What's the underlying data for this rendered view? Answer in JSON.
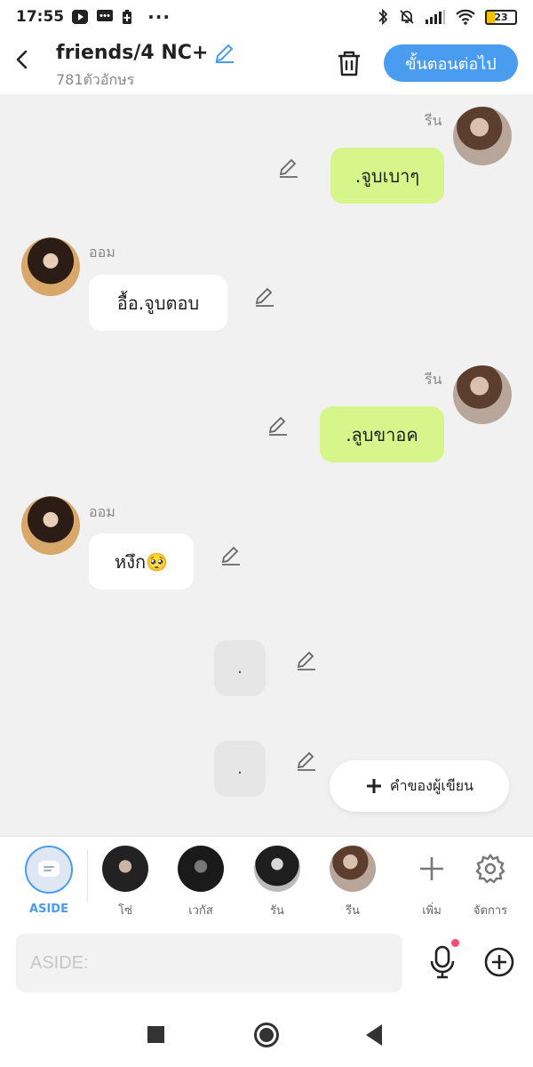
{
  "status_bar": {
    "time": "17:55",
    "battery": "23"
  },
  "header": {
    "title": "friends/4 NC+",
    "subtitle": "781ตัวอักษร",
    "next_label": "ขั้นตอนต่อไป"
  },
  "messages": [
    {
      "sender": "รีน",
      "text": ".จูบเบาๆ"
    },
    {
      "sender": "ออม",
      "text": "อื้อ.จูบตอบ"
    },
    {
      "sender": "รีน",
      "text": ".ลูบขาอค"
    },
    {
      "sender": "ออม",
      "text": "หงึก🥺"
    },
    {
      "text": "."
    },
    {
      "text": "."
    }
  ],
  "author_button": "คำของผู้เขียน",
  "characters": {
    "aside": "ASIDE",
    "items": [
      {
        "name": "โซ่"
      },
      {
        "name": "เวกัส"
      },
      {
        "name": "รัน"
      },
      {
        "name": "รีน"
      }
    ],
    "add_label": "เพิ่ม",
    "manage_label": "จัดการ"
  },
  "composer": {
    "placeholder": "ASIDE:",
    "value": ""
  },
  "colors": {
    "accent": "#4a9cf0",
    "my_bubble": "#d6f58b",
    "their_bubble": "#ffffff",
    "background": "#f1f1f1"
  },
  "icons": [
    "back-icon",
    "edit-pencil-icon",
    "trash-icon",
    "plus-icon",
    "gear-icon",
    "microphone-icon",
    "add-circle-icon"
  ]
}
